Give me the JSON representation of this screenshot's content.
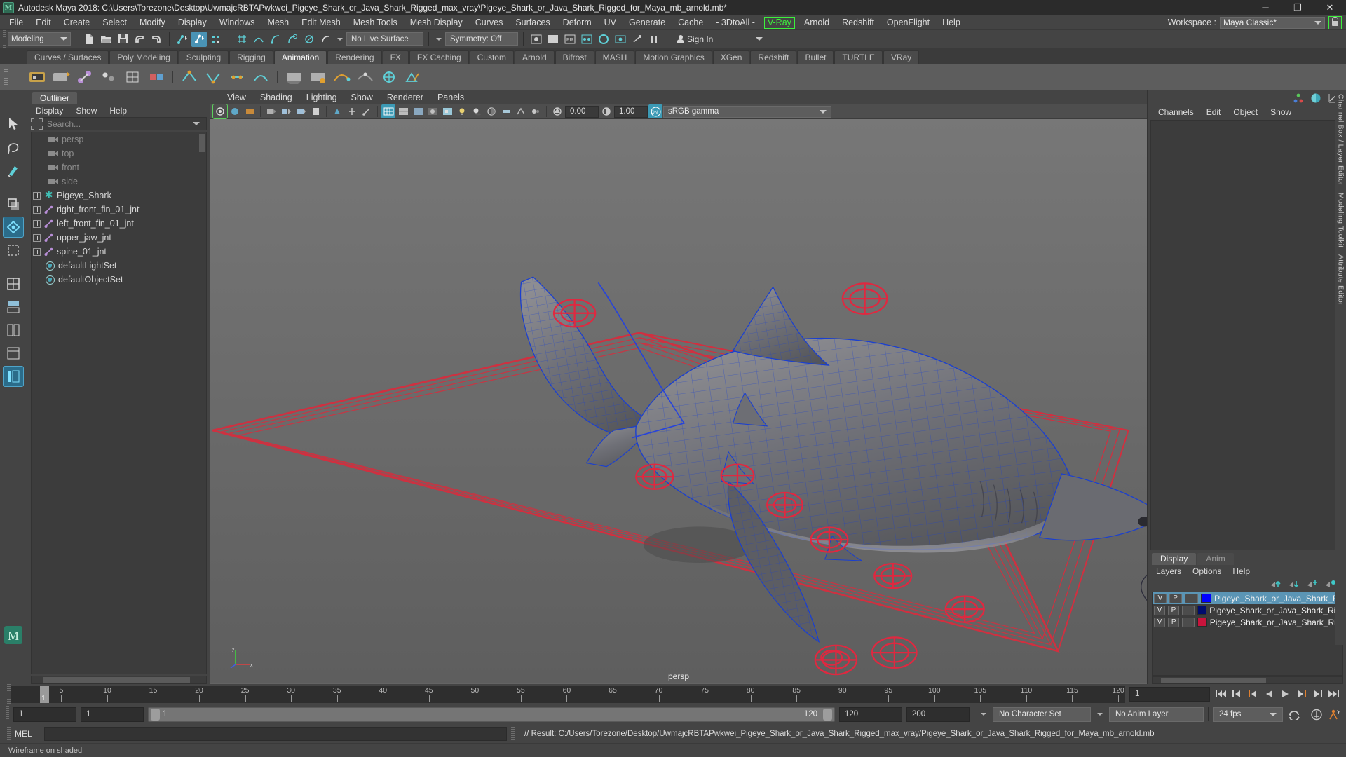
{
  "window": {
    "title": "Autodesk Maya 2018: C:\\Users\\Torezone\\Desktop\\UwmajcRBTAPwkwei_Pigeye_Shark_or_Java_Shark_Rigged_max_vray\\Pigeye_Shark_or_Java_Shark_Rigged_for_Maya_mb_arnold.mb*",
    "minimize": "─",
    "maximize": "❐",
    "close": "✕"
  },
  "menubar": {
    "items": [
      "File",
      "Edit",
      "Create",
      "Select",
      "Modify",
      "Display",
      "Windows",
      "Mesh",
      "Edit Mesh",
      "Mesh Tools",
      "Mesh Display",
      "Curves",
      "Surfaces",
      "Deform",
      "UV",
      "Generate",
      "Cache",
      "- 3DtoAll -"
    ],
    "highlighted": "V-Ray",
    "after_highlight": [
      "Arnold",
      "Redshift",
      "OpenFlight",
      "Help"
    ],
    "workspace_label": "Workspace :",
    "workspace_value": "Maya Classic*",
    "lock_icon": "lock-icon"
  },
  "statusline": {
    "mode": "Modeling",
    "live_surface": "No Live Surface",
    "symmetry": "Symmetry: Off",
    "signin": "Sign In"
  },
  "shelf": {
    "tabs": [
      "Curves / Surfaces",
      "Poly Modeling",
      "Sculpting",
      "Rigging",
      "Animation",
      "Rendering",
      "FX",
      "FX Caching",
      "Custom",
      "Arnold",
      "Bifrost",
      "MASH",
      "Motion Graphics",
      "XGen",
      "Redshift",
      "Bullet",
      "TURTLE",
      "VRay"
    ],
    "active_tab": "Animation"
  },
  "outliner": {
    "tab": "Outliner",
    "menu": [
      "Display",
      "Show",
      "Help"
    ],
    "search_placeholder": "Search...",
    "items": [
      {
        "label": "persp",
        "icon": "camera-icon",
        "dim": true,
        "expandable": false
      },
      {
        "label": "top",
        "icon": "camera-icon",
        "dim": true,
        "expandable": false
      },
      {
        "label": "front",
        "icon": "camera-icon",
        "dim": true,
        "expandable": false
      },
      {
        "label": "side",
        "icon": "camera-icon",
        "dim": true,
        "expandable": false
      },
      {
        "label": "Pigeye_Shark",
        "icon": "group-icon",
        "dim": false,
        "expandable": true
      },
      {
        "label": "right_front_fin_01_jnt",
        "icon": "joint-icon",
        "dim": false,
        "expandable": true
      },
      {
        "label": "left_front_fin_01_jnt",
        "icon": "joint-icon",
        "dim": false,
        "expandable": true
      },
      {
        "label": "upper_jaw_jnt",
        "icon": "joint-icon",
        "dim": false,
        "expandable": true
      },
      {
        "label": "spine_01_jnt",
        "icon": "joint-icon",
        "dim": false,
        "expandable": true
      },
      {
        "label": "defaultLightSet",
        "icon": "set-icon",
        "dim": false,
        "expandable": false
      },
      {
        "label": "defaultObjectSet",
        "icon": "set-icon",
        "dim": false,
        "expandable": false
      }
    ]
  },
  "viewport": {
    "menu": [
      "View",
      "Shading",
      "Lighting",
      "Show",
      "Renderer",
      "Panels"
    ],
    "exposure": "0.00",
    "gamma_value": "1.00",
    "color_mgmt": "sRGB gamma",
    "camera_label": "persp",
    "axis_labels": {
      "y": "y",
      "x": "x",
      "z": "z"
    }
  },
  "channelbox": {
    "menu": [
      "Channels",
      "Edit",
      "Object",
      "Show"
    ]
  },
  "vertical_tabs": [
    "Channel Box / Layer Editor",
    "Modeling Toolkit",
    "Attribute Editor"
  ],
  "layers": {
    "tabs": [
      "Display",
      "Anim"
    ],
    "active_tab": "Display",
    "menu": [
      "Layers",
      "Options",
      "Help"
    ],
    "rows": [
      {
        "v": "V",
        "p": "P",
        "color": "#0000ff",
        "name": "Pigeye_Shark_or_Java_Shark_Rigged",
        "selected": true
      },
      {
        "v": "V",
        "p": "P",
        "color": "#000c6e",
        "name": "Pigeye_Shark_or_Java_Shark_Rigged_Bone",
        "selected": false
      },
      {
        "v": "V",
        "p": "P",
        "color": "#c8143c",
        "name": "Pigeye_Shark_or_Java_Shark_Rigged_Cont",
        "selected": false
      }
    ]
  },
  "timeline": {
    "current_frame": "1",
    "ticks": [
      5,
      10,
      15,
      20,
      25,
      30,
      35,
      40,
      45,
      50,
      55,
      60,
      65,
      70,
      75,
      80,
      85,
      90,
      95,
      100,
      105,
      110,
      115,
      120
    ],
    "range_min": 1,
    "range_max": 120,
    "frame_field": "1",
    "start_field": "1",
    "end_field": "1",
    "range_start_label": "1",
    "range_end_label": "120",
    "playback_end": "120",
    "anim_end": "200",
    "character_set": "No Character Set",
    "anim_layer": "No Anim Layer",
    "fps": "24 fps"
  },
  "command": {
    "mel_label": "MEL",
    "mel_value": "",
    "result": "// Result: C:/Users/Torezone/Desktop/UwmajcRBTAPwkwei_Pigeye_Shark_or_Java_Shark_Rigged_max_vray/Pigeye_Shark_or_Java_Shark_Rigged_for_Maya_mb_arnold.mb"
  },
  "statusbar": {
    "text": "Wireframe on shaded"
  }
}
